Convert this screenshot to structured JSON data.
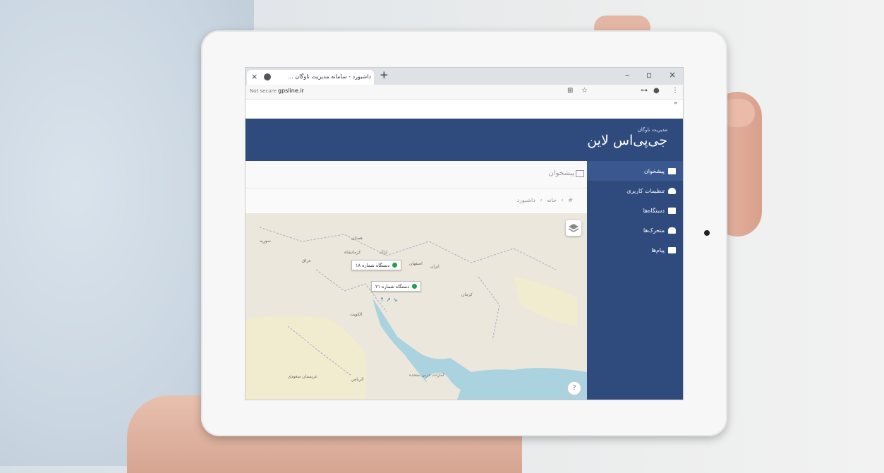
{
  "browser": {
    "tab_title": "داشبورد - سامانه مدیریت ناوگان ...",
    "new_tab": "+",
    "tab_close": "×",
    "minimize": "–",
    "maximize": "▫",
    "close": "×",
    "security_label": "Not secure",
    "url": "gpsline.ir",
    "bookmarks_more": "»"
  },
  "app": {
    "brand_subtitle": "مدیریت ناوگان",
    "brand_title": "جی‌پی‌اس لاین"
  },
  "sidebar": {
    "items": [
      {
        "label": "پیشخوان",
        "icon": "monitor-icon",
        "active": true
      },
      {
        "label": "تنظیمات کاربری",
        "icon": "user-icon",
        "active": false
      },
      {
        "label": "دستگاه‌ها",
        "icon": "device-icon",
        "active": false
      },
      {
        "label": "متحرک‌ها",
        "icon": "car-icon",
        "active": false
      },
      {
        "label": "پیام‌ها",
        "icon": "message-icon",
        "active": false
      }
    ]
  },
  "panel": {
    "title": "پیشخوان",
    "breadcrumb": "# › خانه › داشبورد"
  },
  "map": {
    "markers": [
      {
        "label": "دستگاه شماره ۱۸",
        "status": "online"
      },
      {
        "label": "دستگاه شماره ۲۱",
        "status": "online"
      }
    ],
    "labels": [
      "ایران",
      "عراق",
      "سوریه",
      "اراک",
      "اصفهان",
      "کرمان",
      "عربستان سعودی",
      "الریاض",
      "الکویت",
      "امارات عربی متحده",
      "کرمانشاه",
      "همدان"
    ],
    "help": "?"
  },
  "colors": {
    "sidebar": "#2f4b7e",
    "marker_online": "#19a34a",
    "sea": "#aad3df"
  }
}
